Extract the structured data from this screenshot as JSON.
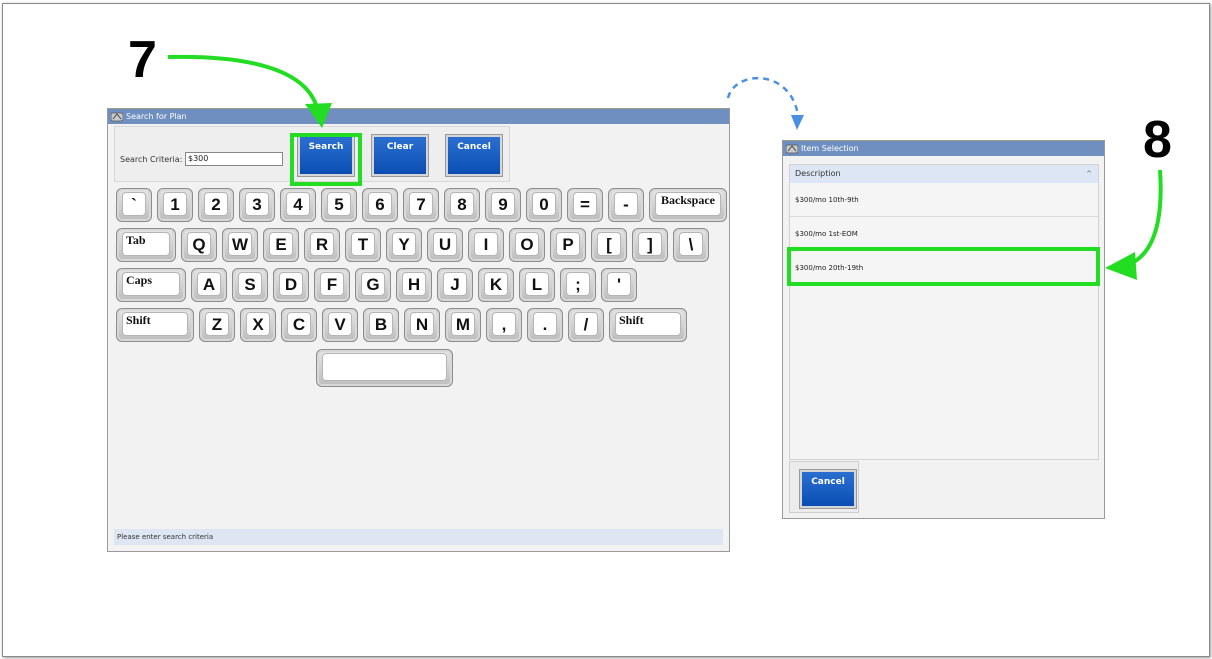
{
  "steps": {
    "first": "7",
    "second": "8"
  },
  "search_dialog": {
    "title": "Search for Plan",
    "criteria_label": "Search Criteria:",
    "criteria_value": "$300",
    "buttons": {
      "search": "Search",
      "clear": "Clear",
      "cancel": "Cancel"
    },
    "keyboard": {
      "row1": [
        "`",
        "1",
        "2",
        "3",
        "4",
        "5",
        "6",
        "7",
        "8",
        "9",
        "0",
        "=",
        "-",
        "Backspace"
      ],
      "row2": [
        "Tab",
        "Q",
        "W",
        "E",
        "R",
        "T",
        "Y",
        "U",
        "I",
        "O",
        "P",
        "[",
        "]",
        "\\"
      ],
      "row3": [
        "Caps",
        "A",
        "S",
        "D",
        "F",
        "G",
        "H",
        "J",
        "K",
        "L",
        ";",
        "'"
      ],
      "row4": [
        "Shift",
        "Z",
        "X",
        "C",
        "V",
        "B",
        "N",
        "M",
        ",",
        ".",
        "/",
        "Shift"
      ],
      "space": ""
    },
    "status": "Please enter search criteria"
  },
  "item_selection": {
    "title": "Item Selection",
    "column_header": "Description",
    "sort_glyph": "^",
    "rows": [
      "$300/mo 10th-9th",
      "$300/mo 1st-EOM",
      "$300/mo 20th-19th"
    ],
    "cancel_label": "Cancel"
  },
  "colors": {
    "highlight": "#22dd22",
    "titlebar": "#6f8fc0",
    "button": "#0a4eb3",
    "dashed_arrow": "#4a90e2"
  }
}
